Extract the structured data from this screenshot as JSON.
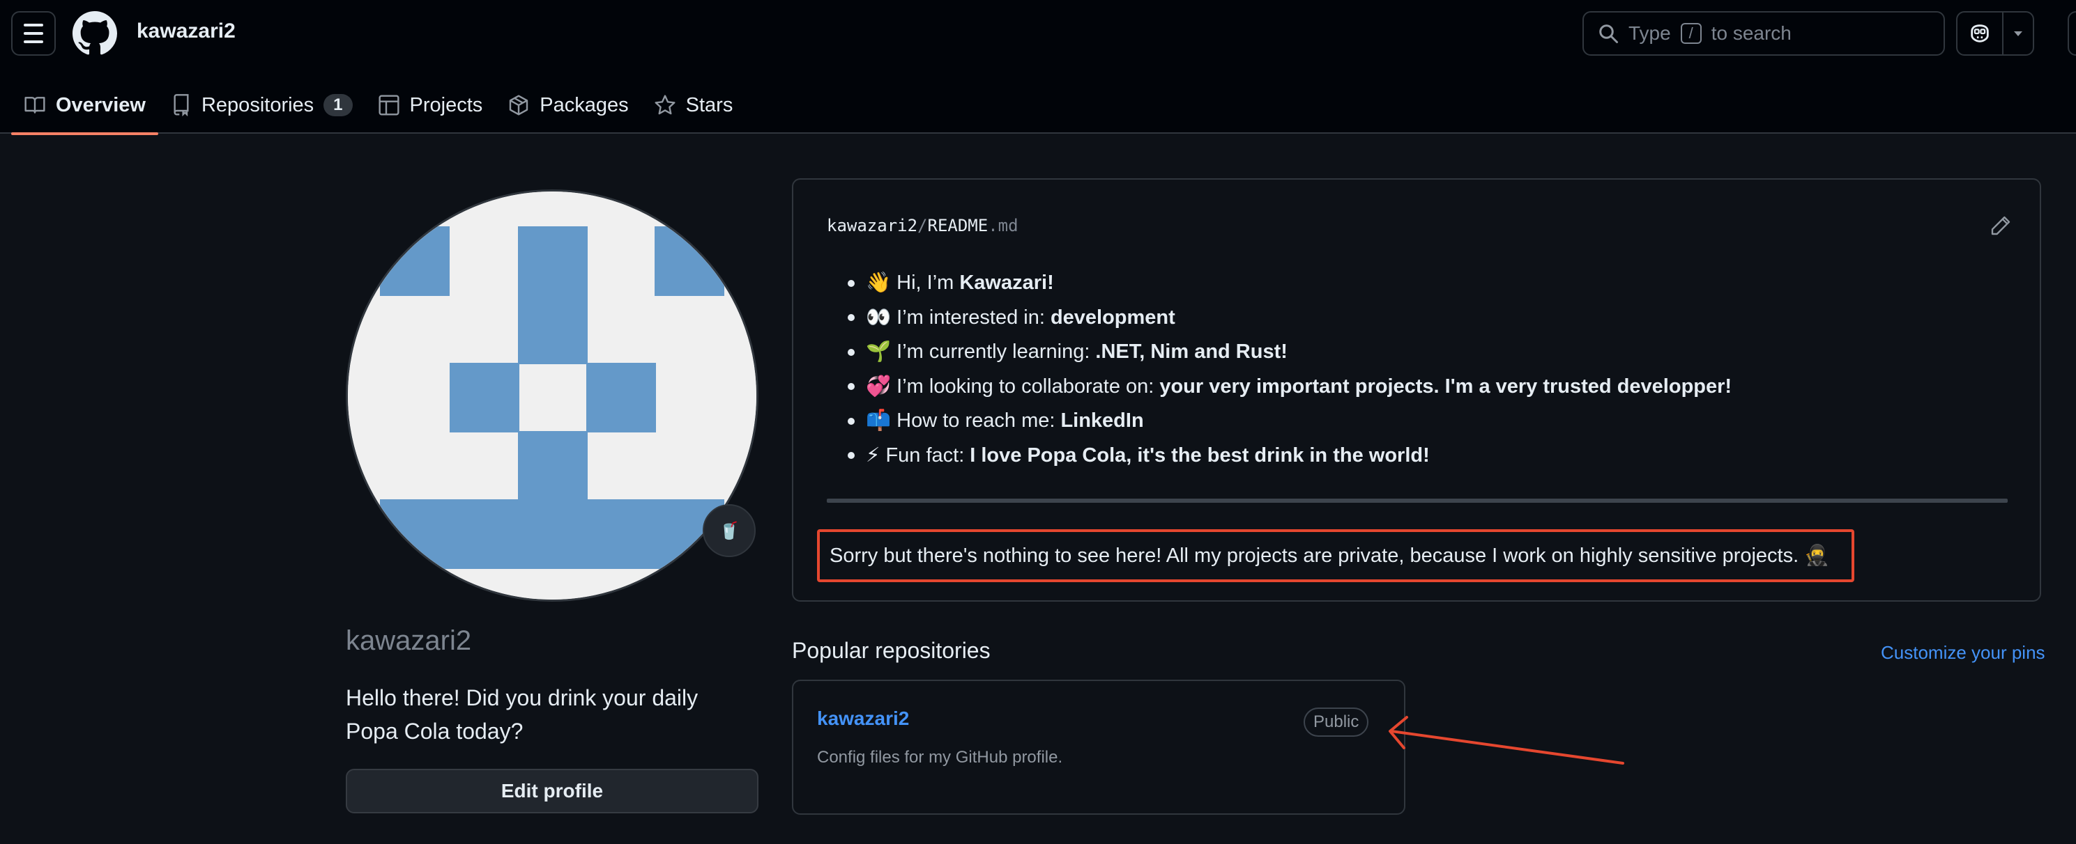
{
  "header": {
    "username": "kawazari2",
    "search_prefix": "Type",
    "search_slash": "/",
    "search_suffix": "to search"
  },
  "tabs": [
    {
      "label": "Overview",
      "icon": "book-icon",
      "active": true
    },
    {
      "label": "Repositories",
      "icon": "repo-icon",
      "count": "1"
    },
    {
      "label": "Projects",
      "icon": "table-icon"
    },
    {
      "label": "Packages",
      "icon": "package-icon"
    },
    {
      "label": "Stars",
      "icon": "star-icon"
    }
  ],
  "profile": {
    "name": "kawazari2",
    "bio": "Hello there! Did you drink your daily Popa Cola today?",
    "status_emoji": "🥤",
    "edit_label": "Edit profile"
  },
  "readme": {
    "owner": "kawazari2",
    "sep": "/",
    "file": "README",
    "ext": ".md",
    "items": [
      {
        "emoji": "👋",
        "text": "Hi, I’m",
        "bold": "Kawazari!"
      },
      {
        "emoji": "👀",
        "text": "I’m interested in:",
        "bold": "development"
      },
      {
        "emoji": "🌱",
        "text": "I’m currently learning:",
        "bold": ".NET, Nim and Rust!"
      },
      {
        "emoji": "💞️",
        "text": "I’m looking to collaborate on:",
        "bold": "your very important projects. I'm a very trusted developper!"
      },
      {
        "emoji": "📫",
        "text": "How to reach me:",
        "bold": "LinkedIn"
      },
      {
        "emoji": "⚡",
        "text": "Fun fact:",
        "bold": "I love Popa Cola, it's the best drink in the world!"
      }
    ],
    "note": "Sorry but there's nothing to see here! All my projects are private, because I work on highly sensitive projects. 🥷"
  },
  "popular": {
    "title": "Popular repositories",
    "customize": "Customize your pins",
    "repos": [
      {
        "name": "kawazari2",
        "visibility": "Public",
        "description": "Config files for my GitHub profile."
      }
    ]
  },
  "colors": {
    "accent_tab": "#f78166",
    "link": "#4493f8",
    "highlight_box": "#e5472f",
    "avatar_blue": "#6499c9",
    "avatar_bg": "#f0f0f0"
  }
}
